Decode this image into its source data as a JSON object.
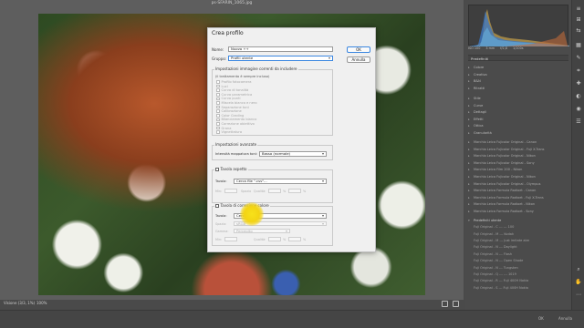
{
  "app": {
    "document_title": "ps-SFARIN_1065.jpg"
  },
  "status_bar": {
    "document_tab": "Visione (3/3, 1%)",
    "zoom": "100%"
  },
  "dialog": {
    "title": "Crea profilo",
    "name_label": "Nome:",
    "name_value": "Nuovo ++",
    "group_label": "Gruppo:",
    "group_value": "Profili utente",
    "ok_label": "OK",
    "cancel_label": "Annulla",
    "settings_section": {
      "title": "Impostazioni immagine correnti da includere",
      "subtitle": "(il trattamento è sempre incluso)",
      "items": [
        "Profilo fotocamera",
        "Luci",
        "Curva di tonalità",
        "Curva parametrica",
        "Curva punti",
        "Miscela bianco e nero",
        "Separazione toni",
        "Calibrazione",
        "Color Grading",
        "Bilanciamento bianco",
        "Correzione obiettivo",
        "Grana",
        "Vignettatura"
      ]
    },
    "advanced_section": {
      "title": "Impostazioni avanzate",
      "tone_map_label": "Intensità mappatura toni:",
      "tone_map_value": "Basso (normale)"
    },
    "lut_section": {
      "title": "Tavola aspetto",
      "table_label": "Tavola:",
      "table_value": "Cerca file \".csv\"...",
      "amount_label": "Min:",
      "space_label": "Spazio",
      "quality_label": "Qualità:",
      "percent": "%"
    },
    "color_lut_section": {
      "title": "Tavola di correzione colore",
      "table_label": "Tavola:",
      "table_value": "Cerca file...",
      "space_label": "Spazio:",
      "space_value": "sRGB",
      "gamma_label": "Gamma:",
      "gamma_value": "Percepito",
      "amount_label": "Min:",
      "quality_label": "Qualità:",
      "percent": "%"
    }
  },
  "histogram": {
    "readout": [
      "ISO 100",
      "3 mm",
      "f/2,8",
      "1/100s"
    ]
  },
  "presets_panel": {
    "title": "Predefiniti",
    "groups_collapsed": [
      "Colore",
      "Creativo",
      "B&N",
      "Ritratti",
      "Stile",
      "Curve",
      "Dettagli",
      "Effetti",
      "Ottica",
      "Granularità"
    ],
    "preset_rows": [
      "Marchio Leica Fujicolor Original - Canon",
      "Marchio Leica Fujicolor Original - Fuji X-Trans",
      "Marchio Leica Fujicolor Original - Nikon",
      "Marchio Leica Fujicolor Original - Sony",
      "Marchio Leica Film 200 - Nikon",
      "Marchio Leica Fujicolor Original - Nikon",
      "Marchio Leica Fujicolor Original - Olympus",
      "Marchio Leica Formula Radioet - Canon",
      "Marchio Leica Formula Radioet - Fuji X-Trans",
      "Marchio Leica Formula Radioet - Nikon",
      "Marchio Leica Formula Radioet - Sony"
    ],
    "user_presets_title": "Predefiniti utente",
    "user_rows": [
      "Fuji Original - C --- --- 100",
      "Fuji Original - M --- Kodak",
      "Fuji Original - M --- Just imitate atm",
      "Fuji Original - N --- Daylight",
      "Fuji Original - N --- Flash",
      "Fuji Original - N --- Open Shade",
      "Fuji Original - N --- Tungsten",
      "Fuji Original - Q --- --- 1019",
      "Fuji Original - R --- Fuji 400H Nokia",
      "Fuji Original - S --- Fuji 400H Nokia"
    ]
  },
  "bottom_bar": {
    "ok": "OK",
    "cancel": "Annulla"
  },
  "colors": {
    "dialog_bg": "#f0f0f0",
    "focus_accent": "#3a86e0",
    "cursor_highlight": "#f3d414",
    "panel_bg": "#4b4b4b"
  },
  "icons": [
    "panel-toggle-icon",
    "grid-icon",
    "compare-icon",
    "histogram-icon",
    "edit-icon",
    "crop-icon",
    "heal-icon",
    "mask-icon",
    "redeye-icon",
    "presets-icon",
    "zoom-icon",
    "hand-icon",
    "more-icon"
  ]
}
